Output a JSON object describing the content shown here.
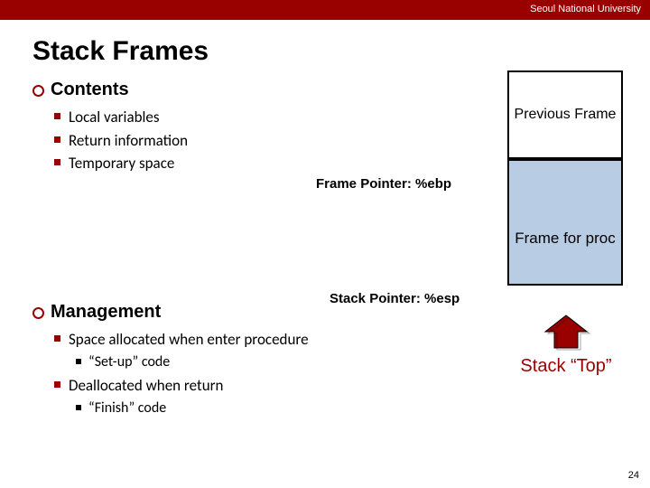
{
  "header": {
    "institution": "Seoul National University"
  },
  "title": "Stack Frames",
  "contents": {
    "heading": "Contents",
    "items": [
      "Local variables",
      "Return information",
      "Temporary space"
    ]
  },
  "management": {
    "heading": "Management",
    "items": [
      {
        "text": "Space allocated when enter procedure",
        "sub": "“Set-up” code"
      },
      {
        "text": "Deallocated when return",
        "sub": "“Finish” code"
      }
    ]
  },
  "diagram": {
    "prev_frame": "Previous Frame",
    "frame_pointer": "Frame Pointer: %ebp",
    "frame_for_proc": "Frame for proc",
    "stack_pointer": "Stack Pointer: %esp",
    "stack_top": "Stack “Top”"
  },
  "page_number": "24"
}
